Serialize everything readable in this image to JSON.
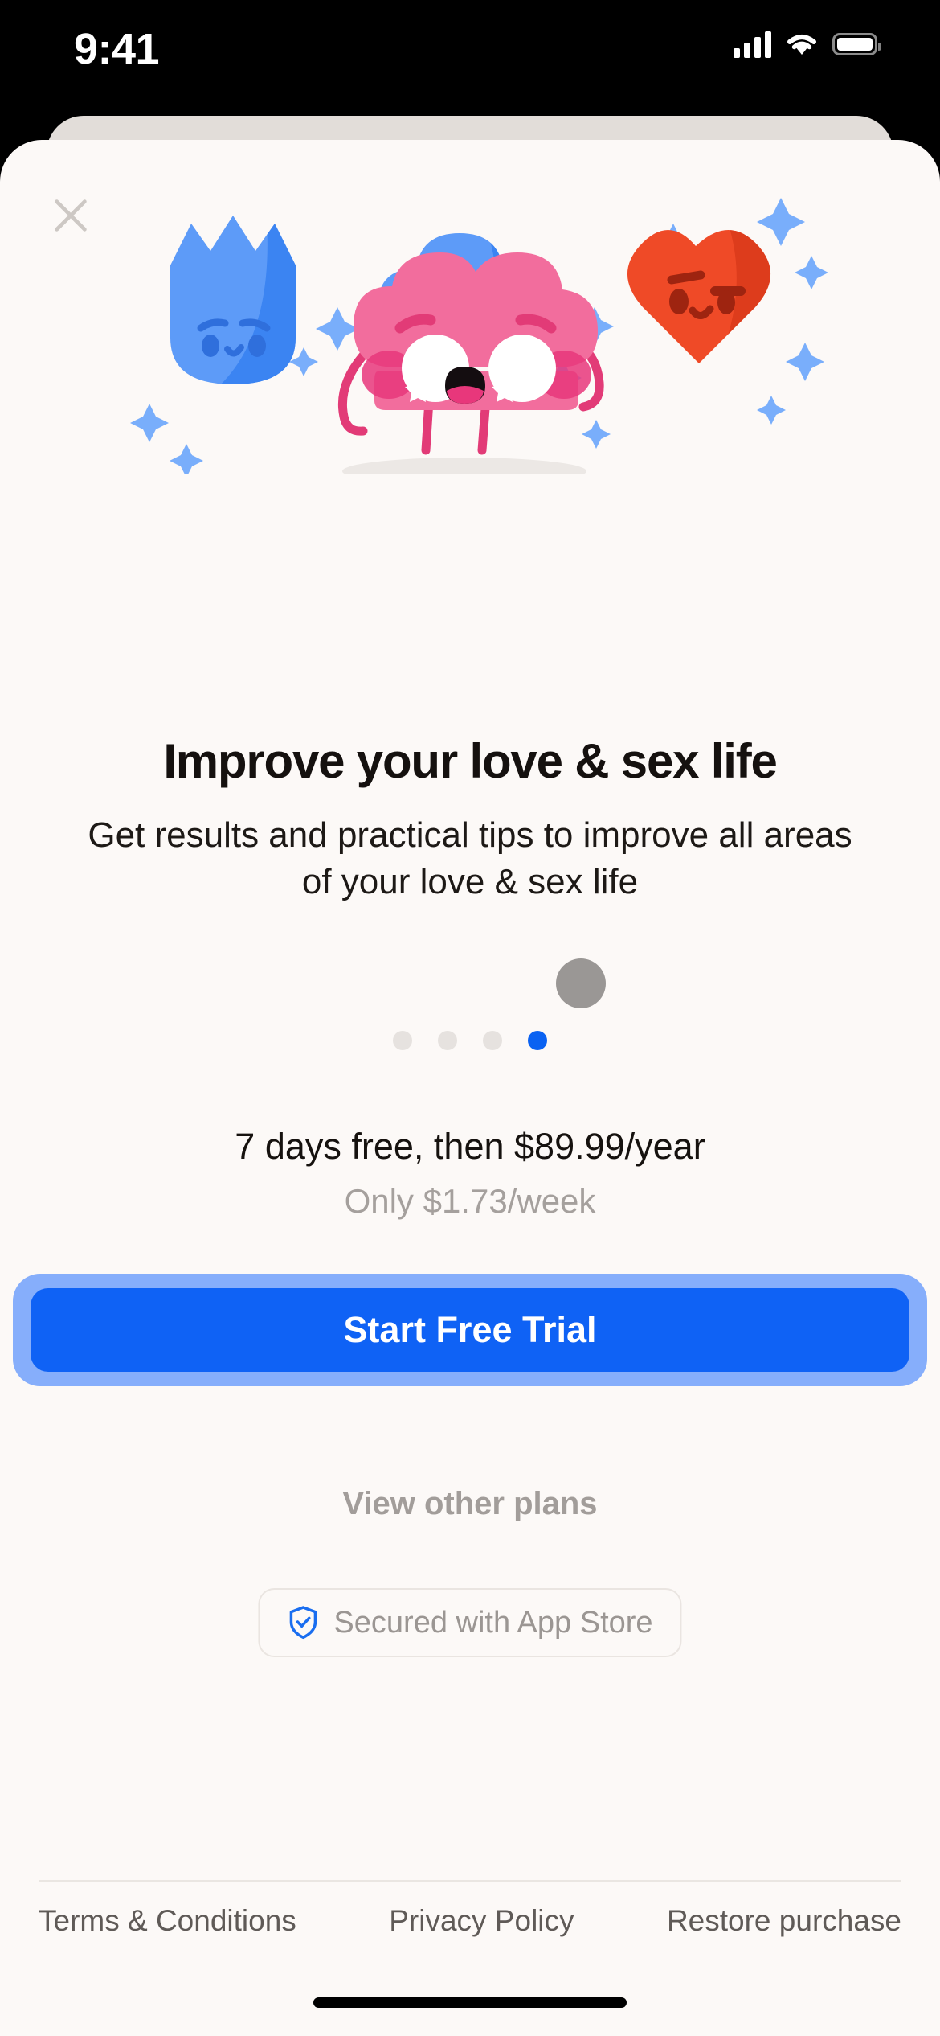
{
  "status_bar": {
    "time": "9:41",
    "signal_icon": "cellular-signal-icon",
    "wifi_icon": "wifi-icon",
    "battery_icon": "battery-icon"
  },
  "paywall": {
    "close_icon": "close-icon",
    "headline": "Improve your love & sex life",
    "subhead": "Get results and practical tips to improve all areas of your love & sex life",
    "pagination": {
      "total": 4,
      "active_index": 3,
      "active_color": "#0a62f2",
      "inactive_color": "#e6e2df"
    },
    "price_main": "7 days free, then $89.99/year",
    "price_sub": "Only $1.73/week",
    "cta_label": "Start Free Trial",
    "cta_color": "#0f62f5",
    "cta_ring_color": "#86aefb",
    "other_plans_label": "View other plans",
    "secured_label": "Secured with App Store",
    "secured_icon": "shield-check-icon",
    "secured_icon_color": "#1a6ef0"
  },
  "illustration": {
    "name": "brain-characters-illustration",
    "brain_color": "#f26d9d",
    "cloud_color": "#5d9bf8",
    "crown_color": "#5d9bf8",
    "heart_color": "#ef4a27",
    "sparkle_color": "#79aefb"
  },
  "footer": {
    "links": [
      {
        "label": "Terms & Conditions",
        "name": "terms-link"
      },
      {
        "label": "Privacy Policy",
        "name": "privacy-link"
      },
      {
        "label": "Restore purchase",
        "name": "restore-link"
      }
    ]
  }
}
